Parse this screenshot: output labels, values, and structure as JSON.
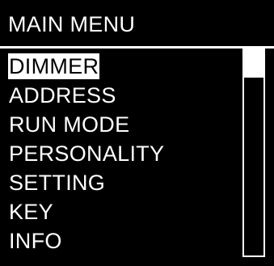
{
  "header": {
    "title": "MAIN MENU"
  },
  "menu": {
    "selected_index": 0,
    "items": [
      {
        "label": "DIMMER"
      },
      {
        "label": "ADDRESS"
      },
      {
        "label": "RUN MODE"
      },
      {
        "label": "PERSONALITY"
      },
      {
        "label": "SETTING"
      },
      {
        "label": "KEY"
      },
      {
        "label": "INFO"
      }
    ]
  },
  "scrollbar": {
    "position_fraction": 0.0
  },
  "colors": {
    "background": "#000000",
    "foreground": "#ffffff"
  }
}
